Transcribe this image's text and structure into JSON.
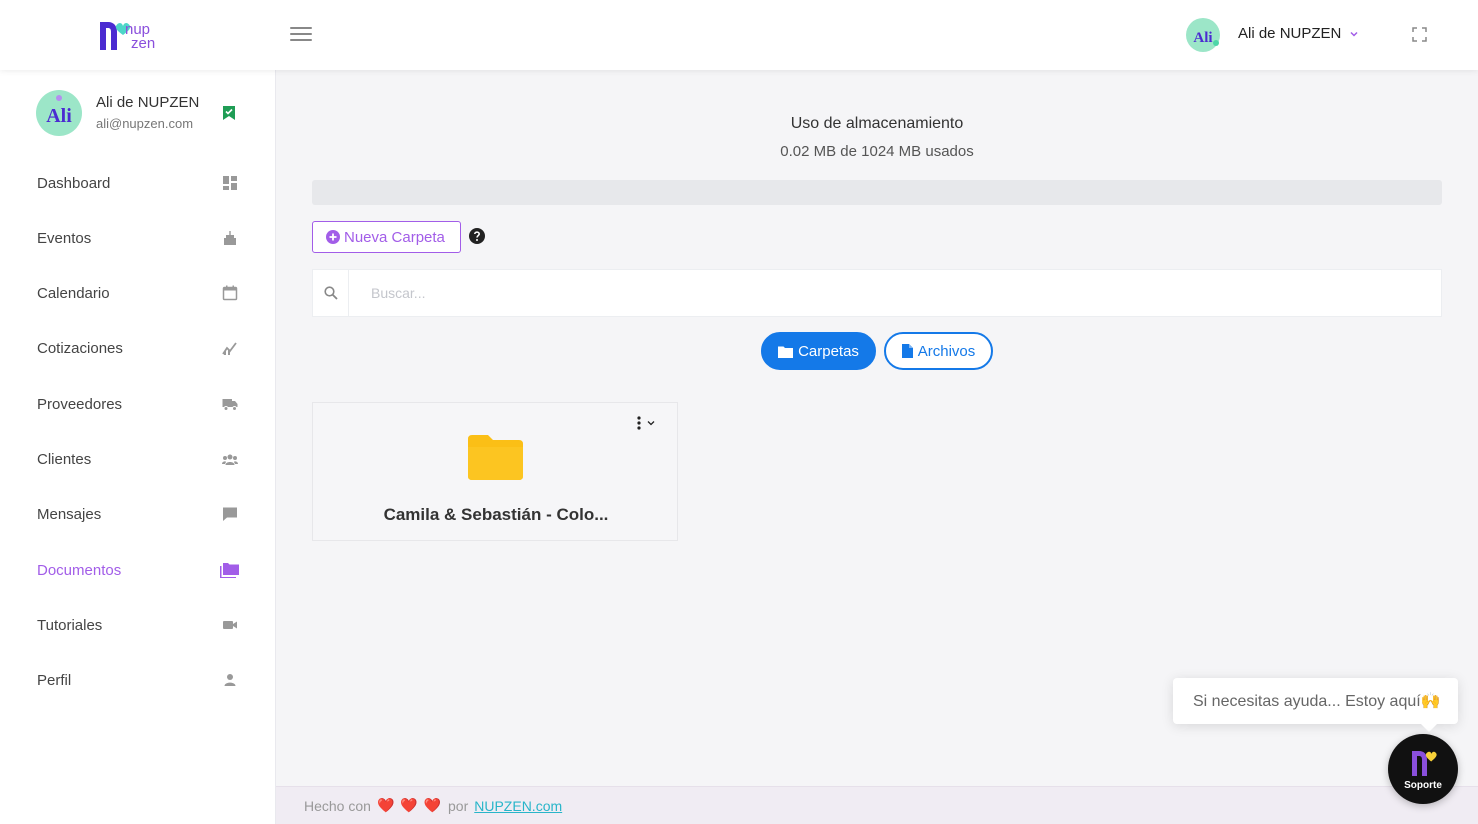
{
  "header": {
    "user_name": "Ali de NUPZEN",
    "avatar_text": "Ali"
  },
  "sidebar": {
    "profile": {
      "name": "Ali de NUPZEN",
      "email": "ali@nupzen.com",
      "avatar_text": "Ali"
    },
    "items": [
      {
        "label": "Dashboard",
        "icon": "dashboard-icon"
      },
      {
        "label": "Eventos",
        "icon": "cake-icon"
      },
      {
        "label": "Calendario",
        "icon": "calendar-icon"
      },
      {
        "label": "Cotizaciones",
        "icon": "chart-icon"
      },
      {
        "label": "Proveedores",
        "icon": "truck-icon"
      },
      {
        "label": "Clientes",
        "icon": "users-icon"
      },
      {
        "label": "Mensajes",
        "icon": "message-icon"
      },
      {
        "label": "Documentos",
        "icon": "folders-icon",
        "active": true
      },
      {
        "label": "Tutoriales",
        "icon": "video-icon"
      },
      {
        "label": "Perfil",
        "icon": "person-icon"
      }
    ]
  },
  "main": {
    "storage_title": "Uso de almacenamiento",
    "storage_used": "0.02 MB de 1024 MB usados",
    "storage_fraction": 2e-05,
    "new_folder_label": "Nueva Carpeta",
    "search_placeholder": "Buscar...",
    "tab_folders": "Carpetas",
    "tab_files": "Archivos",
    "folders": [
      {
        "name": "Camila & Sebastián - Colo..."
      }
    ]
  },
  "footer": {
    "made_with": "Hecho con",
    "hearts": "❤️ ❤️ ❤️",
    "by": "por",
    "link": "NUPZEN.com"
  },
  "support": {
    "bubble": "Si necesitas ayuda... Estoy aquí🙌",
    "label": "Soporte"
  },
  "colors": {
    "accent": "#a25de8",
    "primary": "#1479e8",
    "folder": "#fbbf16",
    "footer_link": "#28b5c9"
  }
}
